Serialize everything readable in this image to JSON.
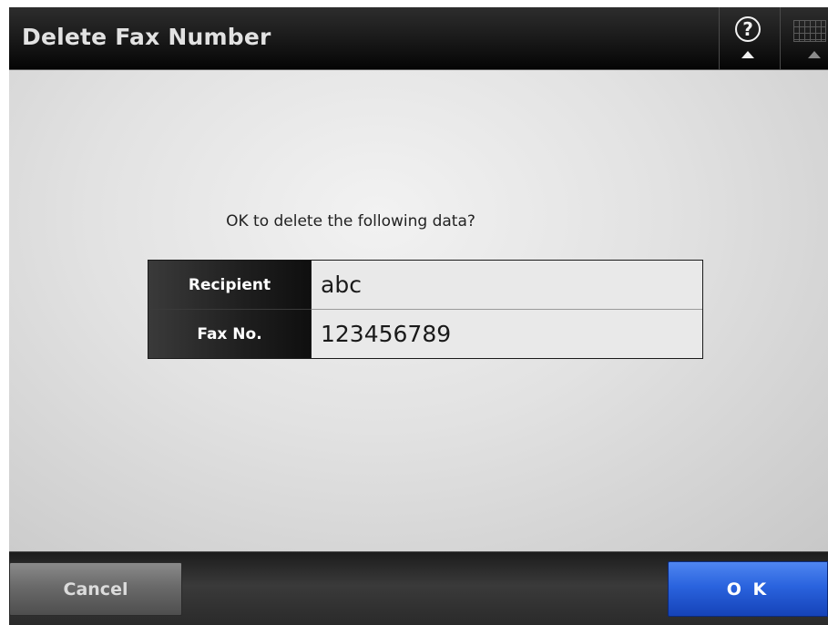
{
  "header": {
    "title": "Delete Fax Number",
    "help_icon_glyph": "?",
    "help_icon": "help-question-icon",
    "keyboard_icon": "keyboard-icon"
  },
  "body": {
    "question": "OK to delete the following data?",
    "table": {
      "rows": [
        {
          "label": "Recipient",
          "value": "abc"
        },
        {
          "label": "Fax No.",
          "value": "123456789"
        }
      ]
    }
  },
  "footer": {
    "cancel_label": "Cancel",
    "ok_label": "O K"
  },
  "colors": {
    "header_background": "#1a1a1a",
    "body_background": "#e2e2e2",
    "ok_button": "#2a63de",
    "cancel_button": "#6a6a6a",
    "label_cell": "#1e1e1e",
    "value_cell": "#e9e9e9"
  }
}
